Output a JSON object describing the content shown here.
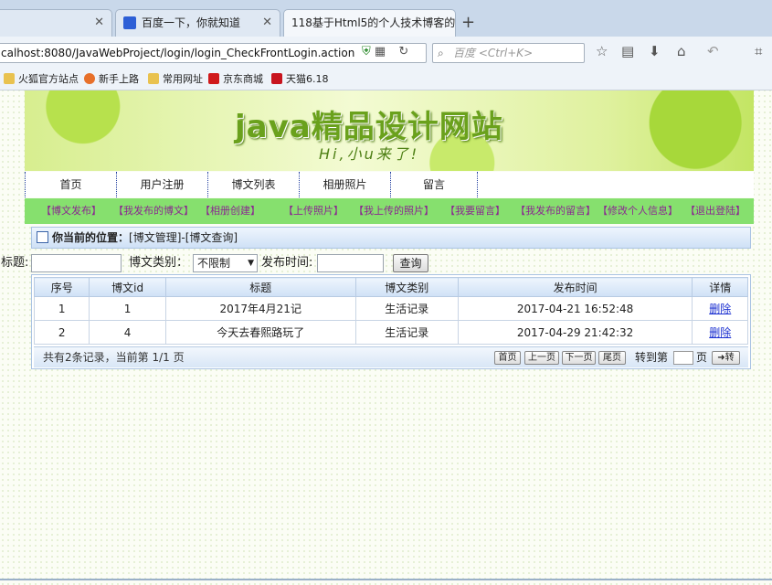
{
  "browser": {
    "tabs": [
      {
        "label": "",
        "active": false
      },
      {
        "label": "百度一下，你就知道",
        "active": false
      },
      {
        "label": "118基于Html5的个人技术博客的",
        "active": true
      }
    ],
    "url": "calhost:8080/JavaWebProject/login/login_CheckFrontLogin.action",
    "search_placeholder": "百度 <Ctrl+K>",
    "bookmarks": [
      "火狐官方站点",
      "新手上路",
      "常用网址",
      "京东商城",
      "天猫6.18"
    ]
  },
  "banner": {
    "title": "java精品设计网站",
    "subtitle": "Hi,小u来了!"
  },
  "main_nav": [
    "首页",
    "用户注册",
    "博文列表",
    "相册照片",
    "留言"
  ],
  "sub_nav": [
    "【博文发布】",
    "【我发布的博文】",
    "【相册创建】",
    "【上传照片】",
    "【我上传的照片】",
    "【我要留言】",
    "【我发布的留言】",
    "【修改个人信息】",
    "【退出登陆】"
  ],
  "location": {
    "label": "你当前的位置：",
    "path": "[博文管理]-[博文查询]"
  },
  "search": {
    "title_label": "标题:",
    "title_value": "",
    "category_label": "博文类别：",
    "category_value": "不限制",
    "time_label": "发布时间:",
    "time_value": "",
    "query_button": "查询"
  },
  "table": {
    "headers": [
      "序号",
      "博文id",
      "标题",
      "博文类别",
      "发布时间",
      "详情"
    ],
    "rows": [
      {
        "no": "1",
        "id": "1",
        "title": "2017年4月21记",
        "category": "生活记录",
        "time": "2017-04-21 16:52:48",
        "action": "删除"
      },
      {
        "no": "2",
        "id": "4",
        "title": "今天去春熙路玩了",
        "category": "生活记录",
        "time": "2017-04-29 21:42:32",
        "action": "删除"
      }
    ]
  },
  "pager": {
    "info": "共有2条记录，当前第 1/1 页",
    "first": "首页",
    "prev": "上一页",
    "next": "下一页",
    "last": "尾页",
    "goto_label": "转到第",
    "page_unit": "页",
    "go_button": "➜转"
  }
}
